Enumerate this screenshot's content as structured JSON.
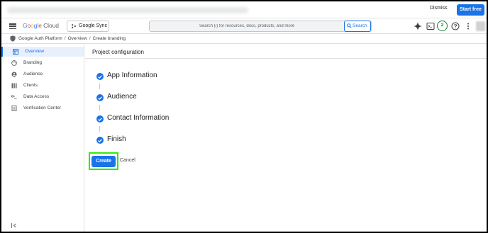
{
  "promo": {
    "dismiss_label": "Dismiss",
    "start_free_label": "Start free"
  },
  "header": {
    "logo_letters": [
      "G",
      "o",
      "o",
      "g",
      "l",
      "e"
    ],
    "logo_product": "Cloud",
    "project_name": "Google Sync",
    "search_placeholder": "Search (/) for resources, docs, products, and more",
    "search_button": "Search",
    "notification_count": "2"
  },
  "breadcrumb": {
    "items": [
      "Google Auth Platform",
      "Overview",
      "Create branding"
    ]
  },
  "sidebar": {
    "items": [
      {
        "label": "Overview",
        "icon": "dashboard-icon",
        "active": true
      },
      {
        "label": "Branding",
        "icon": "palette-icon",
        "active": false
      },
      {
        "label": "Audience",
        "icon": "person-icon",
        "active": false
      },
      {
        "label": "Clients",
        "icon": "list-icon",
        "active": false
      },
      {
        "label": "Data Access",
        "icon": "key-list-icon",
        "active": false
      },
      {
        "label": "Verification Center",
        "icon": "verified-doc-icon",
        "active": false
      }
    ],
    "collapse_icon": "collapse-sidebar-icon"
  },
  "main": {
    "title": "Project configuration",
    "steps": [
      {
        "label": "App Information",
        "completed": true
      },
      {
        "label": "Audience",
        "completed": true
      },
      {
        "label": "Contact Information",
        "completed": true
      },
      {
        "label": "Finish",
        "completed": true
      }
    ],
    "create_label": "Create",
    "cancel_label": "Cancel"
  },
  "colors": {
    "accent": "#1a73e8",
    "highlight_box": "#34e80b",
    "badge_green": "#188038"
  }
}
